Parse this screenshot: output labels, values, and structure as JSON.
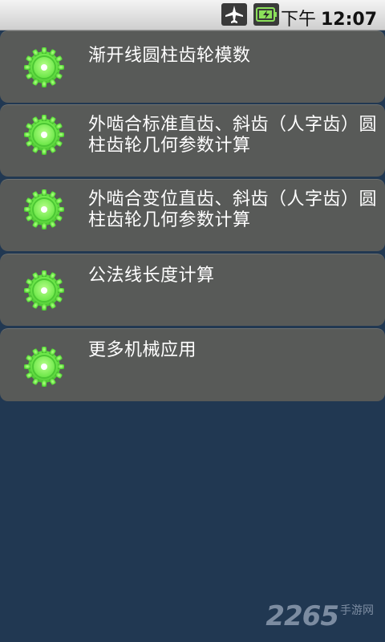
{
  "status_bar": {
    "icons": [
      "airplane-mode-icon",
      "battery-charging-icon"
    ],
    "ampm": "下午",
    "time": "12:07"
  },
  "menu": {
    "items": [
      {
        "label": "渐开线圆柱齿轮模数",
        "icon": "gear-icon"
      },
      {
        "label": "外啮合标准直齿、斜齿（人字齿）圆柱齿轮几何参数计算",
        "icon": "gear-icon"
      },
      {
        "label": "外啮合变位直齿、斜齿（人字齿）圆柱齿轮几何参数计算",
        "icon": "gear-icon"
      },
      {
        "label": "公法线长度计算",
        "icon": "gear-icon"
      },
      {
        "label": "更多机械应用",
        "icon": "gear-icon"
      }
    ]
  },
  "watermark": {
    "number": "2265",
    "site": "手游网"
  },
  "colors": {
    "background": "#213852",
    "item_background": "#585a58",
    "gear_green": "#6ee84a",
    "text": "#ffffff"
  }
}
